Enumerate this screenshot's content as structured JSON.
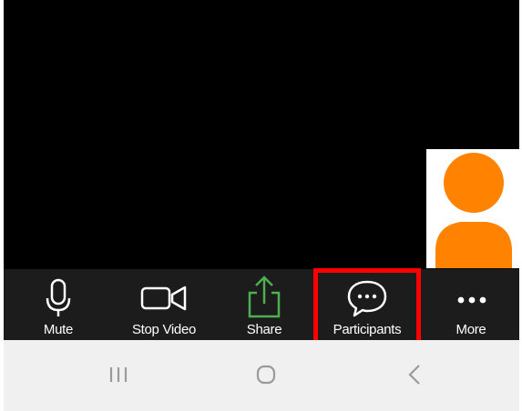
{
  "toolbar": {
    "items": [
      {
        "label": "Mute",
        "icon": "microphone-icon"
      },
      {
        "label": "Stop Video",
        "icon": "video-camera-icon"
      },
      {
        "label": "Share",
        "icon": "share-icon"
      },
      {
        "label": "Participants",
        "icon": "chat-bubble-icon"
      },
      {
        "label": "More",
        "icon": "more-dots-icon"
      }
    ],
    "highlighted_item": "Participants"
  },
  "self_view": {
    "avatar": "user-avatar-icon"
  },
  "navbar": {
    "items": [
      {
        "icon": "recent-apps-icon"
      },
      {
        "icon": "home-icon"
      },
      {
        "icon": "back-icon"
      }
    ]
  },
  "colors": {
    "video_background": "#000000",
    "toolbar_background": "#1c1c1c",
    "share_green": "#4caf50",
    "avatar_orange": "#ff8200",
    "highlight_red": "#ff0000",
    "navbar_background": "#f0f0f0"
  }
}
